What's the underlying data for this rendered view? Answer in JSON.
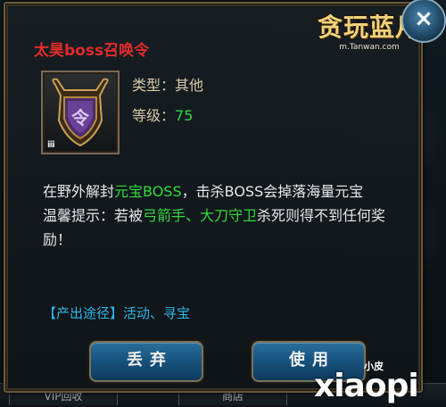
{
  "dialog": {
    "title": "太昊boss召唤令",
    "attributes": [
      {
        "label": "类型：",
        "value": "其他"
      },
      {
        "label": "等级：",
        "value": "75"
      }
    ],
    "item_icon": "purple-shield-token-icon",
    "item_lock_glyph": "ⅲ",
    "description_line1_a": "在野外解封",
    "description_line1_hl": "元宝BOSS",
    "description_line1_b": "，击杀BOSS会掉落海量元宝",
    "tip_a": "温馨提示：若被",
    "tip_hl": "弓箭手、大刀守卫",
    "tip_b": "杀死则得不到任何奖励！",
    "source_text": "【产出途径】活动、寻宝",
    "discard_button": "丢弃",
    "use_button": "使用",
    "close_label": "×"
  },
  "logo": {
    "main": "贪玩蓝月",
    "sub": "m.Tanwan.com"
  },
  "background": {
    "tab_left": "VIP回收",
    "tab_right": "商店"
  },
  "watermark": {
    "small": "小皮",
    "big": "xiaopi"
  },
  "colors": {
    "title_red": "#e22b2b",
    "highlight_green": "#33d83b",
    "source_blue": "#2fb6e6",
    "button_blue": "#185480"
  }
}
